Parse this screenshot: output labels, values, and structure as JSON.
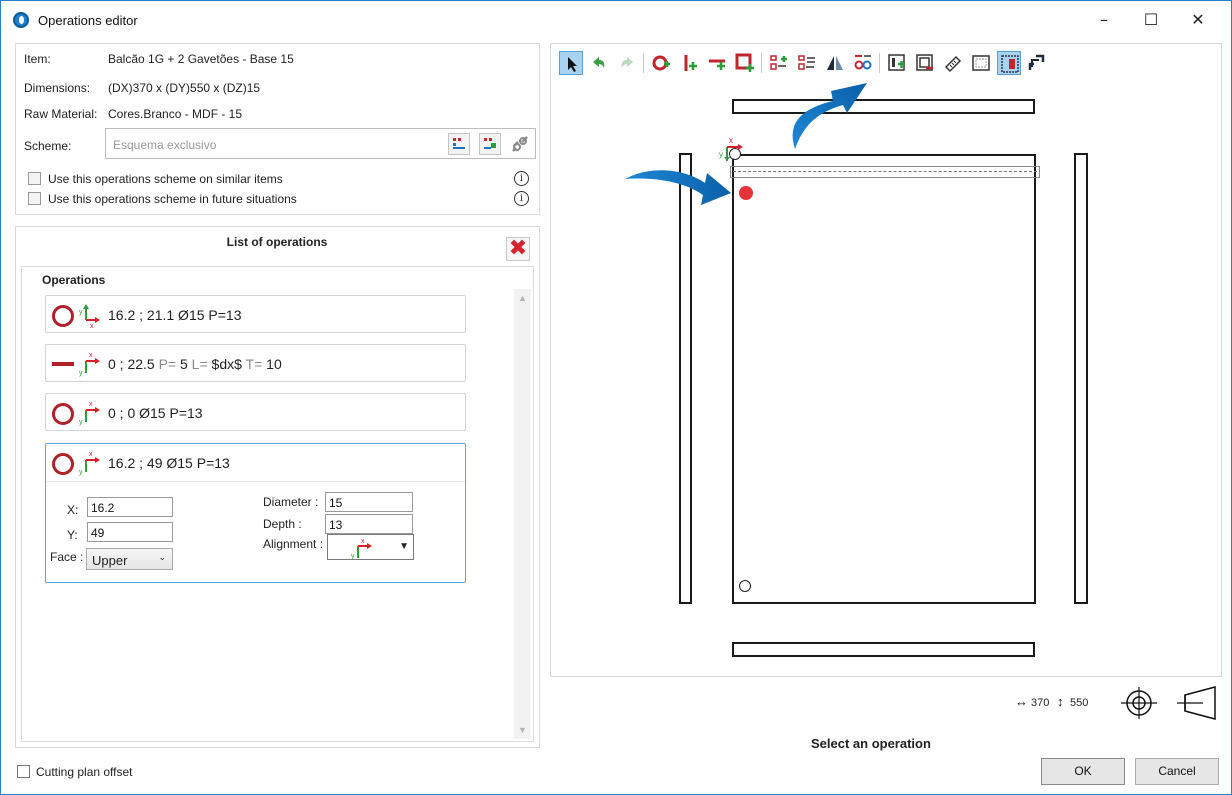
{
  "window": {
    "title": "Operations editor",
    "minimize": "–",
    "maximize": "☐",
    "close": "✕"
  },
  "info": {
    "item_label": "Item:",
    "item_value": "Balcão 1G + 2 Gavetões - Base 15",
    "dimensions_label": "Dimensions:",
    "dimensions_value": "(DX)370 x (DY)550 x (DZ)15",
    "raw_material_label": "Raw Material:",
    "raw_material_value": "Cores.Branco - MDF - 15",
    "scheme_label": "Scheme:",
    "scheme_placeholder": "Esquema exclusivo"
  },
  "options": {
    "similar_items": "Use this operations scheme on similar items",
    "future_situations": "Use this operations scheme in future situations",
    "info_glyph": "i"
  },
  "list": {
    "title": "List of operations",
    "close_glyph": "✖",
    "group_header": "Operations",
    "operations": [
      {
        "kind": "hole",
        "text": "16.2 ; 21.1 Ø15 P=13"
      },
      {
        "kind": "groove",
        "text_main": "0 ; 22.5",
        "p_label": " P=",
        "p_val": " 5",
        "l_label": " L=",
        "l_val": " $dx$",
        "t_label": " T=",
        "t_val": " 10"
      },
      {
        "kind": "hole",
        "text": "0 ; 0 Ø15 P=13"
      },
      {
        "kind": "hole",
        "text": "16.2 ; 49 Ø15 P=13"
      }
    ],
    "selected": {
      "x_label": "X:",
      "x_value": "16.2",
      "y_label": "Y:",
      "y_value": "49",
      "face_label": "Face :",
      "face_value": "Upper",
      "diameter_label": "Diameter :",
      "diameter_value": "15",
      "depth_label": "Depth :",
      "depth_value": "13",
      "alignment_label": "Alignment :"
    }
  },
  "axis": {
    "x": "x",
    "y": "y"
  },
  "bottom": {
    "dx": "370",
    "dy": "550",
    "status": "Select an operation",
    "ok": "OK",
    "cancel": "Cancel",
    "cutting_plan_offset": "Cutting plan offset"
  },
  "colors": {
    "accent": "#1e88d6",
    "hole": "#b02029",
    "marker": "#e8323a",
    "selected_border": "#5aa6e0"
  }
}
